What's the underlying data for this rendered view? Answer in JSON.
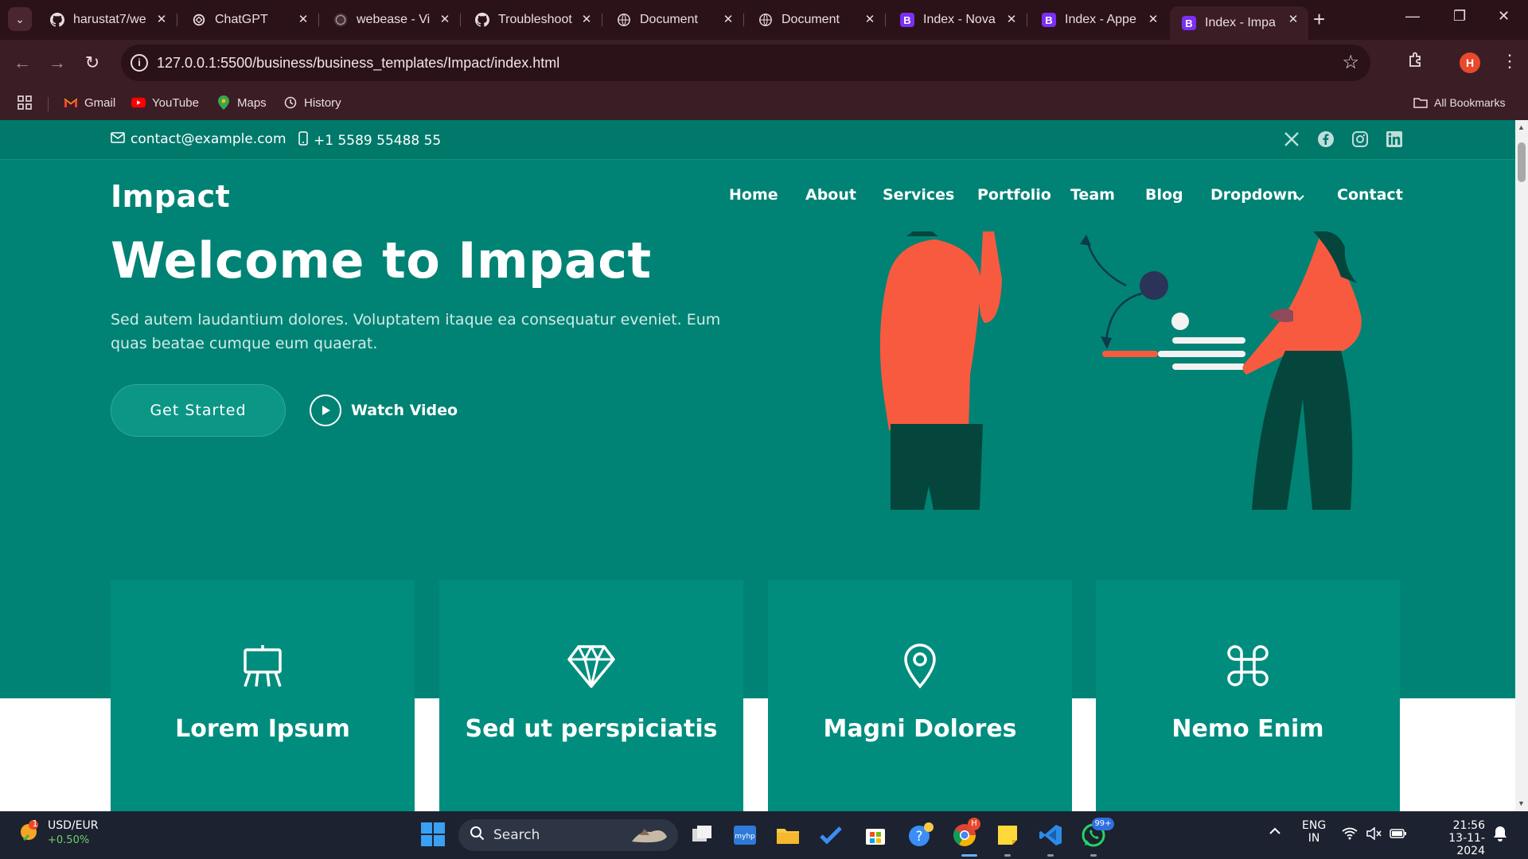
{
  "browser": {
    "tabs": [
      {
        "title": "harustat7/we",
        "icon": "github-icon",
        "active": false
      },
      {
        "title": "ChatGPT",
        "icon": "chatgpt-icon",
        "active": false
      },
      {
        "title": "webease - Vi",
        "icon": "github-icon",
        "active": false
      },
      {
        "title": "Troubleshoot",
        "icon": "github-icon",
        "active": false
      },
      {
        "title": "Document",
        "icon": "globe-icon",
        "active": false
      },
      {
        "title": "Document",
        "icon": "globe-icon",
        "active": false
      },
      {
        "title": "Index - Nova",
        "icon": "bootstrap-icon",
        "active": false
      },
      {
        "title": "Index - Appe",
        "icon": "bootstrap-icon",
        "active": false
      },
      {
        "title": "Index - Impa",
        "icon": "bootstrap-icon",
        "active": true
      }
    ],
    "url": "127.0.0.1:5500/business/business_templates/Impact/index.html",
    "profile_initial": "H",
    "bookmarks": [
      {
        "label": "Gmail"
      },
      {
        "label": "YouTube"
      },
      {
        "label": "Maps"
      },
      {
        "label": "History"
      }
    ],
    "all_bookmarks": "All Bookmarks"
  },
  "page": {
    "topbar": {
      "email": "contact@example.com",
      "phone": "+1 5589 55488 55",
      "socials": [
        "x-icon",
        "facebook-icon",
        "instagram-icon",
        "linkedin-icon"
      ]
    },
    "brand": "Impact",
    "nav": [
      "Home",
      "About",
      "Services",
      "Portfolio",
      "Team",
      "Blog",
      "Dropdown",
      "Contact"
    ],
    "hero": {
      "title": "Welcome to Impact",
      "subtitle": "Sed autem laudantium dolores. Voluptatem itaque ea consequatur eveniet. Eum quas beatae cumque eum quaerat.",
      "cta": "Get Started",
      "watch": "Watch Video"
    },
    "cards": [
      {
        "title": "Lorem Ipsum",
        "icon": "easel-icon"
      },
      {
        "title": "Sed ut perspiciatis",
        "icon": "gem-icon"
      },
      {
        "title": "Magni Dolores",
        "icon": "geo-pin-icon"
      },
      {
        "title": "Nemo Enim",
        "icon": "command-icon"
      }
    ]
  },
  "taskbar": {
    "ticker_name": "USD/EUR",
    "ticker_change": "+0.50%",
    "ticker_badge": "1",
    "search": "Search",
    "lang": "ENG",
    "region": "IN",
    "time": "21:56",
    "date": "13-11-2024",
    "whatsapp_badge": "99+",
    "chrome_badge": "H"
  },
  "colors": {
    "teal": "#008374",
    "teal_dark": "#00796b",
    "accent_orange": "#f85a40",
    "chrome_bg": "#3b1d25"
  }
}
